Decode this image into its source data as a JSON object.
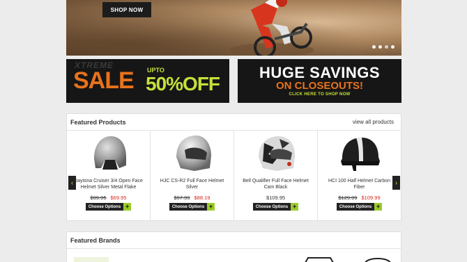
{
  "hero": {
    "cta_label": "SHOP NOW"
  },
  "promo_left": {
    "watermark": "XTREME",
    "sale_word": "SALE",
    "upto": "UPTO",
    "discount": "50%OFF"
  },
  "promo_right": {
    "headline": "HUGE SAVINGS",
    "subline": "ON CLOSEOUTS!",
    "cta": "CLICK HERE TO SHOP NOW"
  },
  "featured": {
    "title": "Featured Products",
    "view_all": "view all products",
    "products": [
      {
        "name": "Daytona Cruiser 3/4 Open Face Helmet Silver Metal Flake",
        "old_price": "$99.95",
        "price": "$69.95",
        "on_sale": true,
        "button": "Choose Options"
      },
      {
        "name": "HJC CS-R2 Full Face Helmet Silver",
        "old_price": "$97.99",
        "price": "$88.19",
        "on_sale": true,
        "button": "Choose Options"
      },
      {
        "name": "Bell Qualifier Full Face Helmet Cam Black",
        "old_price": "",
        "price": "$109.95",
        "on_sale": false,
        "button": "Choose Options"
      },
      {
        "name": "HCI 100 Half Helmet Carbon Fiber",
        "old_price": "$129.99",
        "price": "$109.99",
        "on_sale": true,
        "button": "Choose Options"
      }
    ]
  },
  "carousel": {
    "prev": "‹",
    "next": "›"
  },
  "brands": {
    "title": "Featured Brands"
  },
  "colors": {
    "accent_orange": "#e8721c",
    "accent_green": "#c6e03a",
    "sale_red": "#d9281c"
  }
}
